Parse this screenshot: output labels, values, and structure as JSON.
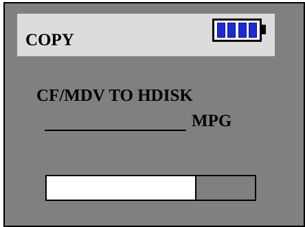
{
  "screen": {
    "title": "COPY",
    "background_color": "#808080",
    "header_color": "#dcdcdc"
  },
  "battery": {
    "icon": "battery-full-icon",
    "cells_filled": 4,
    "cells_total": 4,
    "cell_color": "#1a2bd6"
  },
  "copy": {
    "direction": "CF/MDV TO HDISK",
    "file_name": "",
    "file_type": "MPG"
  },
  "progress": {
    "fraction": 0.72,
    "fill_color": "#ffffff"
  }
}
